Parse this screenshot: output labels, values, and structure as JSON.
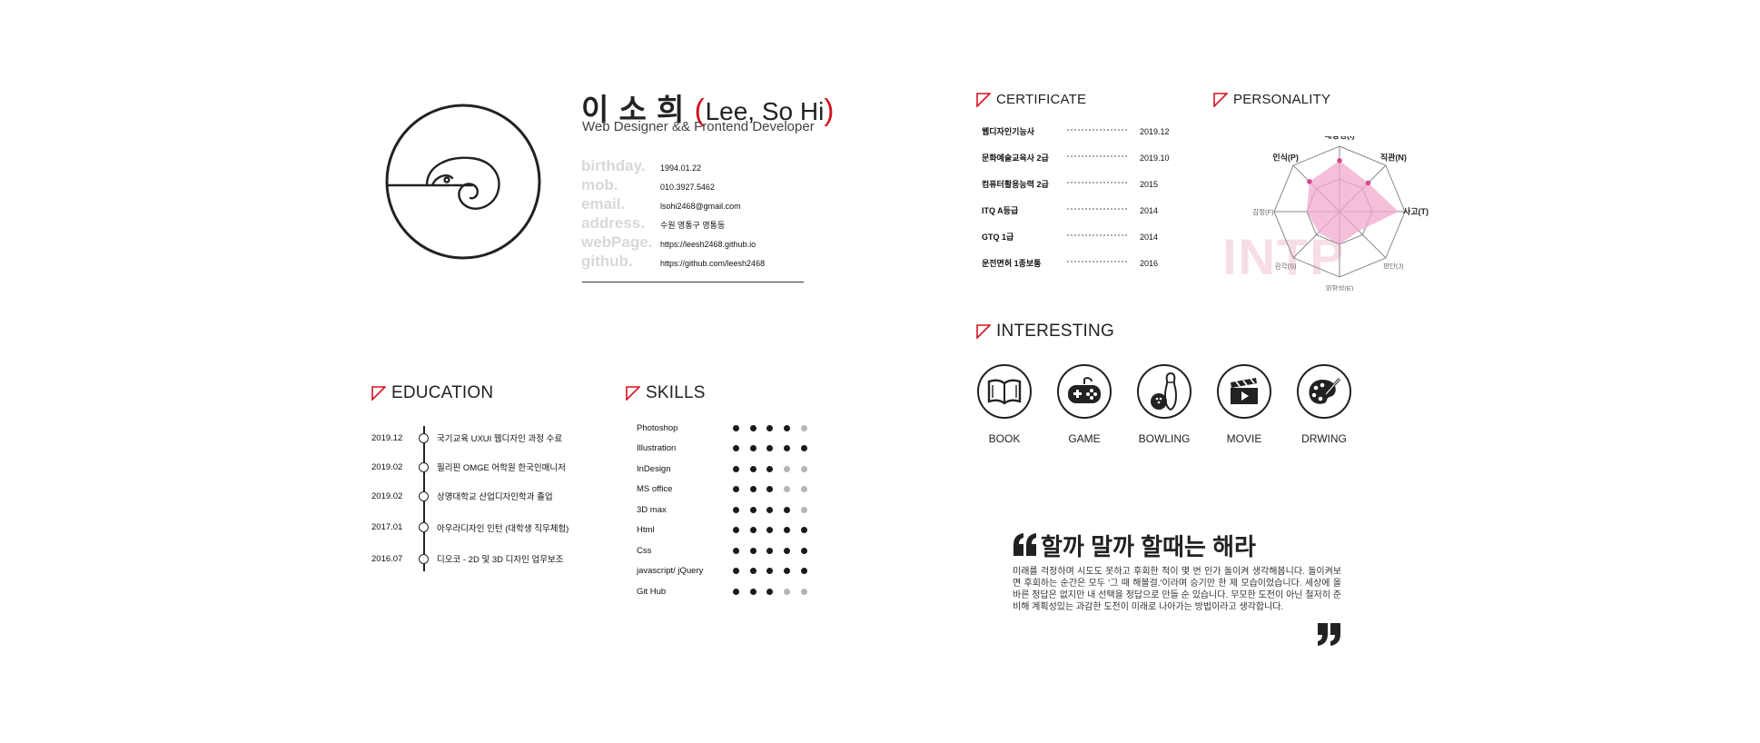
{
  "profile": {
    "name_kr": "이 소 희",
    "paren_open": "(",
    "name_en": "Lee, So Hi",
    "paren_close": ")",
    "role": "Web Designer && Frontend Developer",
    "labels": [
      "birthday.",
      "mob.",
      "email.",
      "address.",
      "webPage.",
      "github."
    ],
    "values": [
      "1994.01.22",
      "010.3927.5462",
      "lsohi2468@gmail.com",
      "수원 영통구 영통동",
      "https://leesh2468.github.io",
      "https://github.com/leesh2468"
    ]
  },
  "certificate": {
    "title": "CERTIFICATE",
    "items": [
      {
        "name": "웹디자인기능사",
        "year": "2019.12"
      },
      {
        "name": "문화예술교육사 2급",
        "year": "2019.10"
      },
      {
        "name": "컴퓨터활용능력 2급",
        "year": "2015"
      },
      {
        "name": "ITQ A등급",
        "year": "2014"
      },
      {
        "name": "GTQ 1급",
        "year": "2014"
      },
      {
        "name": "운전면허 1종보통",
        "year": "2016"
      }
    ]
  },
  "personality": {
    "title": "PERSONALITY",
    "watermark": "INTP",
    "axes": [
      "내향성(I)",
      "직관(N)",
      "사고(T)",
      "판단(J)",
      "외향성(E)",
      "감각(S)",
      "감정(F)",
      "인식(P)"
    ],
    "axes_bold": [
      true,
      true,
      true,
      false,
      false,
      false,
      false,
      true
    ],
    "values": [
      0.78,
      0.62,
      0.9,
      0.42,
      0.5,
      0.45,
      0.5,
      0.65
    ],
    "fill_color": "#f2a9cc",
    "point_color": "#d14b8f"
  },
  "interesting": {
    "title": "INTERESTING",
    "items": [
      {
        "label": "BOOK",
        "icon": "book-icon"
      },
      {
        "label": "GAME",
        "icon": "gamepad-icon"
      },
      {
        "label": "BOWLING",
        "icon": "bowling-icon"
      },
      {
        "label": "MOVIE",
        "icon": "clapperboard-icon"
      },
      {
        "label": "DRWING",
        "icon": "palette-icon"
      }
    ]
  },
  "education": {
    "title": "EDUCATION",
    "items": [
      {
        "date": "2019.12",
        "text": "국기교육 UXUI 웹디자인 과정 수료"
      },
      {
        "date": "2019.02",
        "text": "필리핀 OMGE 어학원 한국인매니저"
      },
      {
        "date": "2019.02",
        "text": "상명대학교 산업디자인학과 졸업"
      },
      {
        "date": "2017.01",
        "text": "아우라디자인 인턴 (대학생 직무체험)"
      },
      {
        "date": "2016.07",
        "text": "디오코 - 2D 및 3D 디자인 업무보조"
      }
    ]
  },
  "skills": {
    "title": "SKILLS",
    "items": [
      {
        "name": "Photoshop",
        "level": 4
      },
      {
        "name": "Illustration",
        "level": 5
      },
      {
        "name": "InDesign",
        "level": 3
      },
      {
        "name": "MS office",
        "level": 3
      },
      {
        "name": "3D max",
        "level": 4
      },
      {
        "name": "Html",
        "level": 5
      },
      {
        "name": "Css",
        "level": 5
      },
      {
        "name": "javascript/ jQuery",
        "level": 5
      },
      {
        "name": "Git Hub",
        "level": 3
      }
    ],
    "max": 5,
    "on_color": "#1a1a1a",
    "off_color": "#b5b5b5"
  },
  "quote": {
    "title": "할까 말까 할때는 해라",
    "body": "미래를 걱정하며 시도도 못하고 후회한 적이 몇 번 인가 돌이켜 생각해봅니다. 돌이켜보면 후회하는 순간은 모두 '그 때 해볼걸.'이라며 승기만 한 제 모습이었습니다. 세상에 올바른 정답은 없지만 내 선택을 정답으로 만들 순 있습니다. 무모한 도전이 아닌 철저히 준비해 계획성있는 과감한 도전이 미래로 나아가는 방법이라고 생각합니다."
  },
  "accent": "#d3131f"
}
